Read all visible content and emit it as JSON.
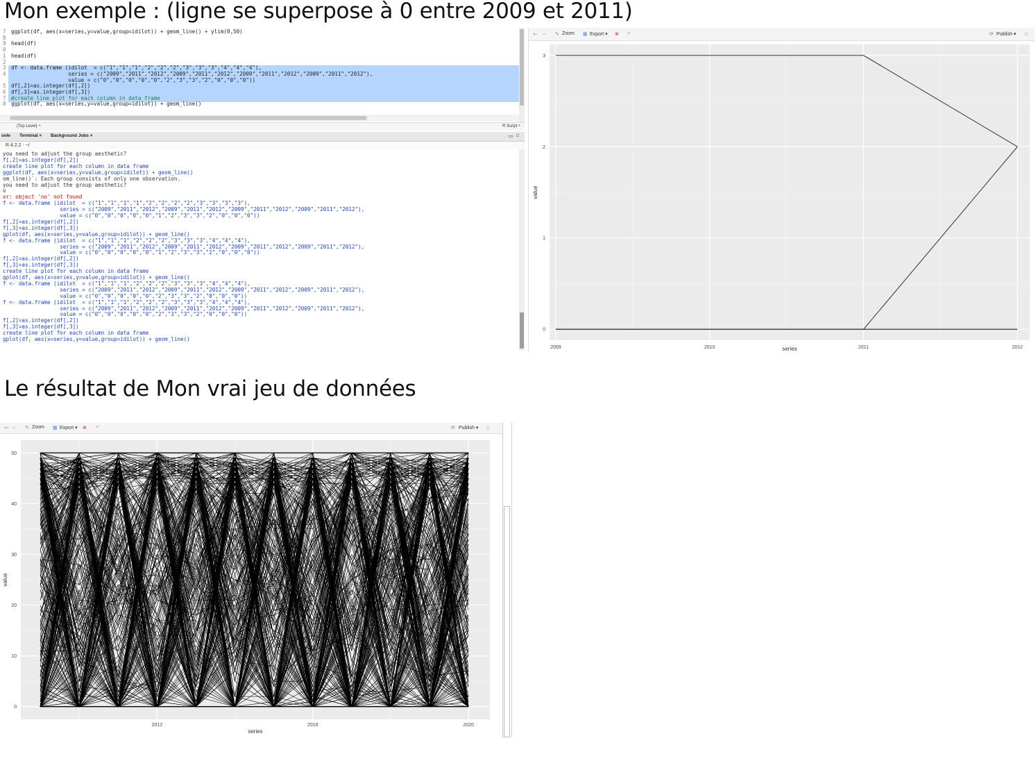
{
  "heading_top": "Mon exemple : (ligne se superpose à 0 entre 2009 et 2011)",
  "heading_bottom": "Le résultat de Mon vrai jeu de données",
  "editor": {
    "lines": [
      {
        "num": "7",
        "text": "ggplot(df, aes(x=series,y=value,group=idilot)) + geom_line() + ylim(0,50)"
      },
      {
        "num": "8",
        "text": ""
      },
      {
        "num": "9",
        "text": "head(df)"
      },
      {
        "num": "0",
        "text": ""
      },
      {
        "num": "1",
        "text": "head(df)"
      },
      {
        "num": "2",
        "text": ""
      },
      {
        "num": "3",
        "text": "df <- data.frame (idilot  = c(\"1\",\"1\",\"1\",\"2\",\"2\",\"2\",\"3\",\"3\",\"3\",\"4\",\"4\",\"4\"),"
      },
      {
        "num": "4",
        "text": "                  series = c(\"2009\",\"2011\",\"2012\",\"2009\",\"2011\",\"2012\",\"2009\",\"2011\",\"2012\",\"2009\",\"2011\",\"2012\"),"
      },
      {
        "num": "",
        "text": "                  value = c(\"0\",\"0\",\"0\",\"0\",\"0\",\"2\",\"3\",\"3\",\"2\",\"0\",\"0\",\"0\"))"
      },
      {
        "num": "5",
        "text": "df[,2]=as.integer(df[,2])"
      },
      {
        "num": "6",
        "text": "df[,3]=as.integer(df[,3])"
      },
      {
        "num": "7",
        "text": "#create line plot for each column in data frame"
      },
      {
        "num": "8",
        "text": "ggplot(df, aes(x=series,y=value,group=idilot)) + geom_line()"
      }
    ],
    "status_left": "(Top Level) ÷",
    "status_right": "R Script ÷"
  },
  "console_tabs": [
    "sole",
    "Terminal ×",
    "Background Jobs ×"
  ],
  "console_header": "R 4.2.2 · ~/",
  "console_lines": [
    {
      "text": "you need to adjust the group aesthetic?",
      "color": "#333"
    },
    {
      "text": "f[,2]=as.integer(df[,2])",
      "color": "#1a3fcc"
    },
    {
      "text": "create line plot for each column in data frame",
      "color": "#1a3fcc"
    },
    {
      "text": "ggplot(df, aes(x=series,y=value,group=idilot)) + geom_line()",
      "color": "#1a3fcc"
    },
    {
      "text": "om_line()`: Each group consists of only one observation.",
      "color": "#333"
    },
    {
      "text": "you need to adjust the group aesthetic?",
      "color": "#333"
    },
    {
      "text": "o",
      "color": "#d00"
    },
    {
      "text": "or: object 'no' not found",
      "color": "#d00"
    },
    {
      "text": "f <- data.frame (idilot  = c(\"1\",\"1\",\"1\",\"1\",\"2\",\"2\",\"2\",\"2\",\"3\",\"3\",\"3\",\"3\"),",
      "color": "#1a3fcc"
    },
    {
      "text": "                  series = c(\"2009\",\"2011\",\"2012\",\"2009\",\"2011\",\"2012\",\"2009\",\"2011\",\"2012\",\"2009\",\"2011\",\"2012\"),",
      "color": "#1a3fcc"
    },
    {
      "text": "                  value = c(\"0\",\"0\",\"0\",\"0\",\"0\",\"1\",\"2\",\"3\",\"3\",\"2\",\"0\",\"0\",\"0\"))",
      "color": "#1a3fcc"
    },
    {
      "text": "f[,2]=as.integer(df[,2])",
      "color": "#1a3fcc"
    },
    {
      "text": "f[,3]=as.integer(df[,3])",
      "color": "#1a3fcc"
    },
    {
      "text": "gplot(df, aes(x=series,y=value,group=idilot)) + geom_line()",
      "color": "#1a3fcc"
    },
    {
      "text": "f <- data.frame (idilot  = c(\"1\",\"1\",\"1\",\"2\",\"2\",\"2\",\"3\",\"3\",\"3\",\"4\",\"4\",\"4\"),",
      "color": "#1a3fcc"
    },
    {
      "text": "                  series = c(\"2009\",\"2011\",\"2012\",\"2009\",\"2011\",\"2012\",\"2009\",\"2011\",\"2012\",\"2009\",\"2011\",\"2012\"),",
      "color": "#1a3fcc"
    },
    {
      "text": "                  value = c(\"0\",\"0\",\"0\",\"0\",\"0\",\"1\",\"2\",\"3\",\"3\",\"2\",\"0\",\"0\",\"0\"))",
      "color": "#1a3fcc"
    },
    {
      "text": "f[,2]=as.integer(df[,2])",
      "color": "#1a3fcc"
    },
    {
      "text": "f[,3]=as.integer(df[,3])",
      "color": "#1a3fcc"
    },
    {
      "text": "create line plot for each column in data frame",
      "color": "#1a3fcc"
    },
    {
      "text": "gplot(df, aes(x=series,y=value,group=idilot)) + geom_line()",
      "color": "#1a3fcc"
    },
    {
      "text": "f <- data.frame (idilot  = c(\"1\",\"1\",\"1\",\"2\",\"2\",\"2\",\"3\",\"3\",\"3\",\"4\",\"4\",\"4\"),",
      "color": "#1a3fcc"
    },
    {
      "text": "                  series = c(\"2009\",\"2011\",\"2012\",\"2009\",\"2011\",\"2012\",\"2009\",\"2011\",\"2012\",\"2009\",\"2011\",\"2012\"),",
      "color": "#1a3fcc"
    },
    {
      "text": "                  value = c(\"0\",\"0\",\"0\",\"0\",\"0\",\"2\",\"3\",\"3\",\"2\",\"0\",\"0\",\"0\"))",
      "color": "#1a3fcc"
    },
    {
      "text": "f <- data.frame (idilot  = c(\"1\",\"1\",\"1\",\"2\",\"2\",\"2\",\"3\",\"3\",\"3\",\"4\",\"4\",\"4\"),",
      "color": "#1a3fcc"
    },
    {
      "text": "                  series = c(\"2009\",\"2011\",\"2012\",\"2009\",\"2011\",\"2012\",\"2009\",\"2011\",\"2012\",\"2009\",\"2011\",\"2012\"),",
      "color": "#1a3fcc"
    },
    {
      "text": "                  value = c(\"0\",\"0\",\"0\",\"0\",\"0\",\"2\",\"3\",\"3\",\"2\",\"0\",\"0\",\"0\"))",
      "color": "#1a3fcc"
    },
    {
      "text": "f[,2]=as.integer(df[,2])",
      "color": "#1a3fcc"
    },
    {
      "text": "f[,3]=as.integer(df[,3])",
      "color": "#1a3fcc"
    },
    {
      "text": "create line plot for each column in data frame",
      "color": "#1a3fcc"
    },
    {
      "text": "gplot(df, aes(x=series,y=value,group=idilot)) + geom_line()",
      "color": "#1a3fcc"
    }
  ],
  "plot_toolbar": {
    "zoom": "Zoom",
    "export": "Export ▾",
    "publish": "Publish ▾"
  },
  "chart_data": [
    {
      "type": "line",
      "xlabel": "series",
      "ylabel": "value",
      "x_ticks": [
        2009,
        2010,
        2011,
        2012
      ],
      "y_ticks": [
        0,
        1,
        2,
        3
      ],
      "xlim": [
        2009,
        2012
      ],
      "ylim": [
        0,
        3
      ],
      "grid": true,
      "series": [
        {
          "x": [
            2009,
            2011,
            2012
          ],
          "y": [
            0,
            0,
            0
          ]
        },
        {
          "x": [
            2009,
            2011,
            2012
          ],
          "y": [
            0,
            0,
            2
          ]
        },
        {
          "x": [
            2009,
            2011,
            2012
          ],
          "y": [
            3,
            3,
            2
          ]
        },
        {
          "x": [
            2009,
            2011,
            2012
          ],
          "y": [
            0,
            0,
            0
          ]
        }
      ]
    },
    {
      "type": "line",
      "xlabel": "series",
      "ylabel": "value",
      "x_ticks": [
        2012,
        2016,
        2020
      ],
      "y_ticks": [
        0,
        10,
        20,
        30,
        40,
        50
      ],
      "xlim": [
        2009,
        2020
      ],
      "ylim": [
        0,
        50
      ],
      "grid": true,
      "description_series_count": "many groups, values 0–50 integers, years 2009–2020"
    }
  ]
}
